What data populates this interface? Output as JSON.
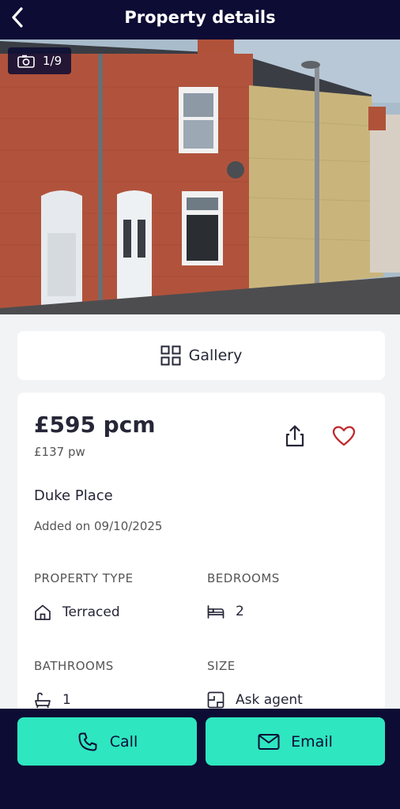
{
  "header": {
    "title": "Property details"
  },
  "photo": {
    "counter": "1/9",
    "total_dots": 9,
    "active_dot": 0
  },
  "gallery": {
    "label": "Gallery"
  },
  "listing": {
    "price": "£595 pcm",
    "price_weekly": "£137 pw",
    "address": "Duke Place",
    "added": "Added on 09/10/2025",
    "attributes": [
      {
        "label": "PROPERTY TYPE",
        "value": "Terraced",
        "icon": "house-icon"
      },
      {
        "label": "BEDROOMS",
        "value": "2",
        "icon": "bed-icon"
      },
      {
        "label": "BATHROOMS",
        "value": "1",
        "icon": "bath-icon"
      },
      {
        "label": "SIZE",
        "value": "Ask agent",
        "icon": "floorplan-icon"
      }
    ]
  },
  "actions": {
    "call": "Call",
    "email": "Email"
  },
  "colors": {
    "navy": "#0c0c34",
    "accent": "#2ee6c0",
    "heart": "#c0282e"
  }
}
